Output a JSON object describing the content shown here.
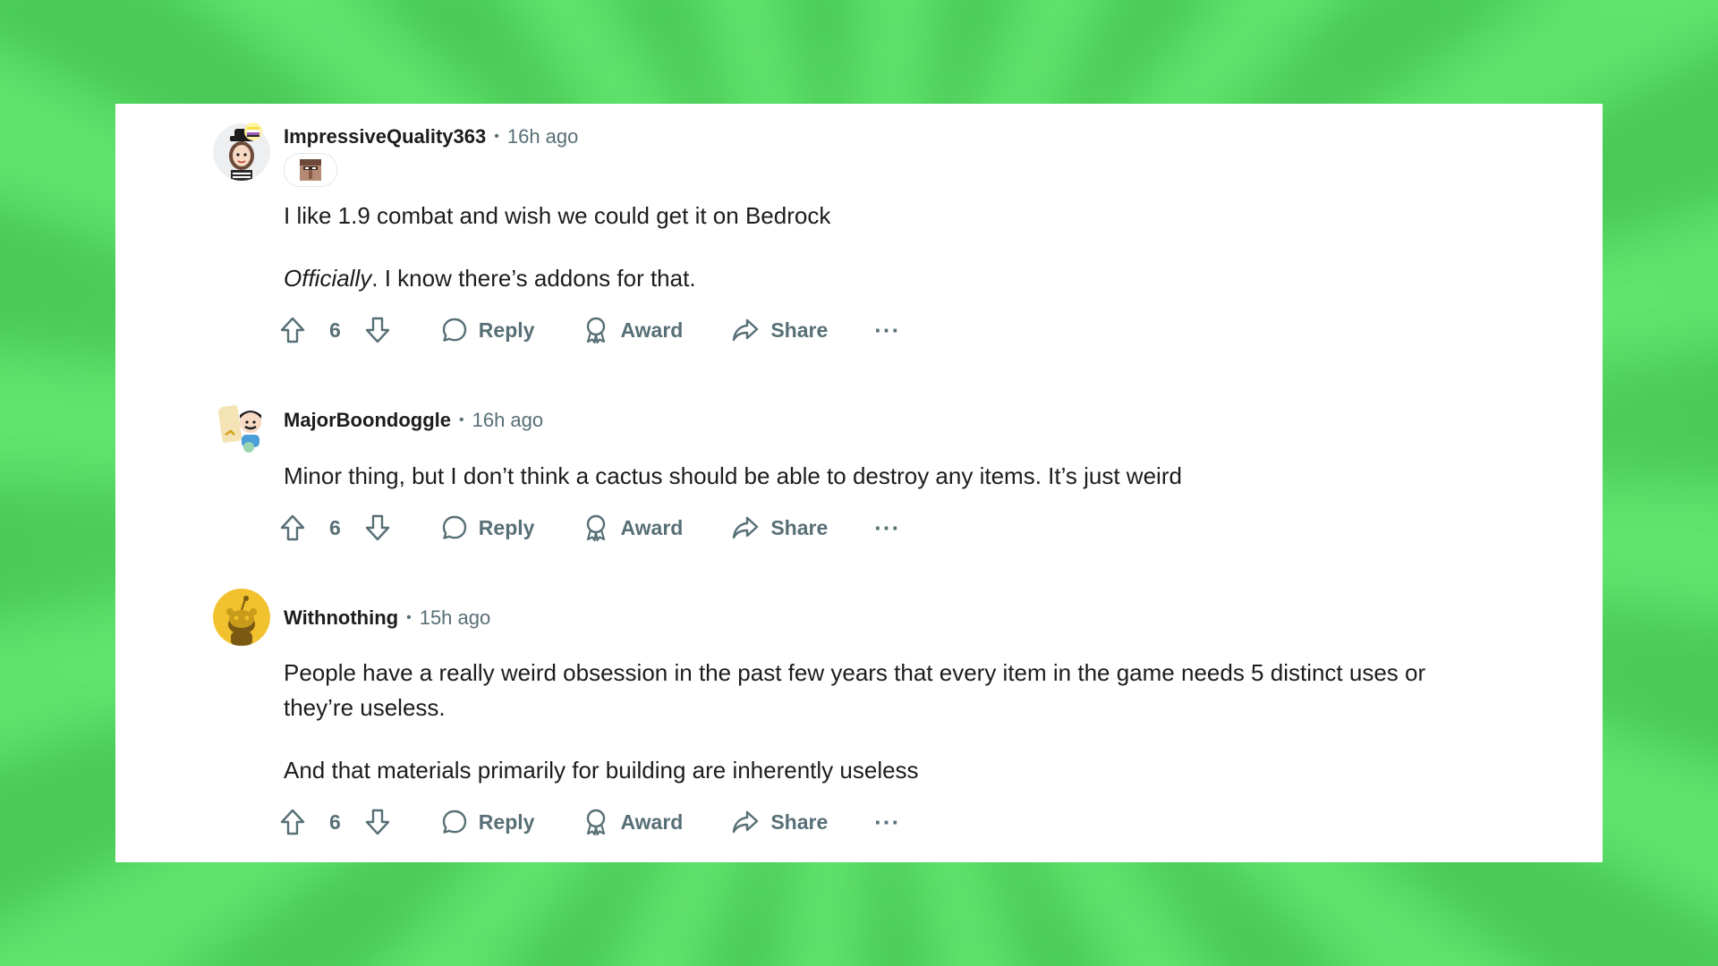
{
  "comments": [
    {
      "username": "ImpressiveQuality363",
      "time": "16h ago",
      "paragraphs": [
        {
          "text": "I like 1.9 combat and wish we could get it on Bedrock"
        },
        {
          "italic": "Officially",
          "text": ". I know there’s addons for that."
        }
      ],
      "score": "6"
    },
    {
      "username": "MajorBoondoggle",
      "time": "16h ago",
      "paragraphs": [
        {
          "text": "Minor thing, but I don’t think a cactus should be able to destroy any items. It’s just weird"
        }
      ],
      "score": "6"
    },
    {
      "username": "Withnothing",
      "time": "15h ago",
      "paragraphs": [
        {
          "text": "People have a really weird obsession in the past few years that every item in the game needs 5 distinct uses or they’re useless."
        },
        {
          "text": "And that materials primarily for building are inherently useless"
        }
      ],
      "score": "6"
    }
  ],
  "actions": {
    "reply_label": "Reply",
    "award_label": "Award",
    "share_label": "Share",
    "more_label": "···"
  },
  "colors": {
    "background": "#5fe36d",
    "card": "#ffffff",
    "text": "#1c1c1c",
    "meta": "#576f76",
    "snoo_yellow": "#f2c12e"
  },
  "icons": [
    "upvote-icon",
    "downvote-icon",
    "reply-icon",
    "award-icon",
    "share-icon",
    "more-icon"
  ]
}
